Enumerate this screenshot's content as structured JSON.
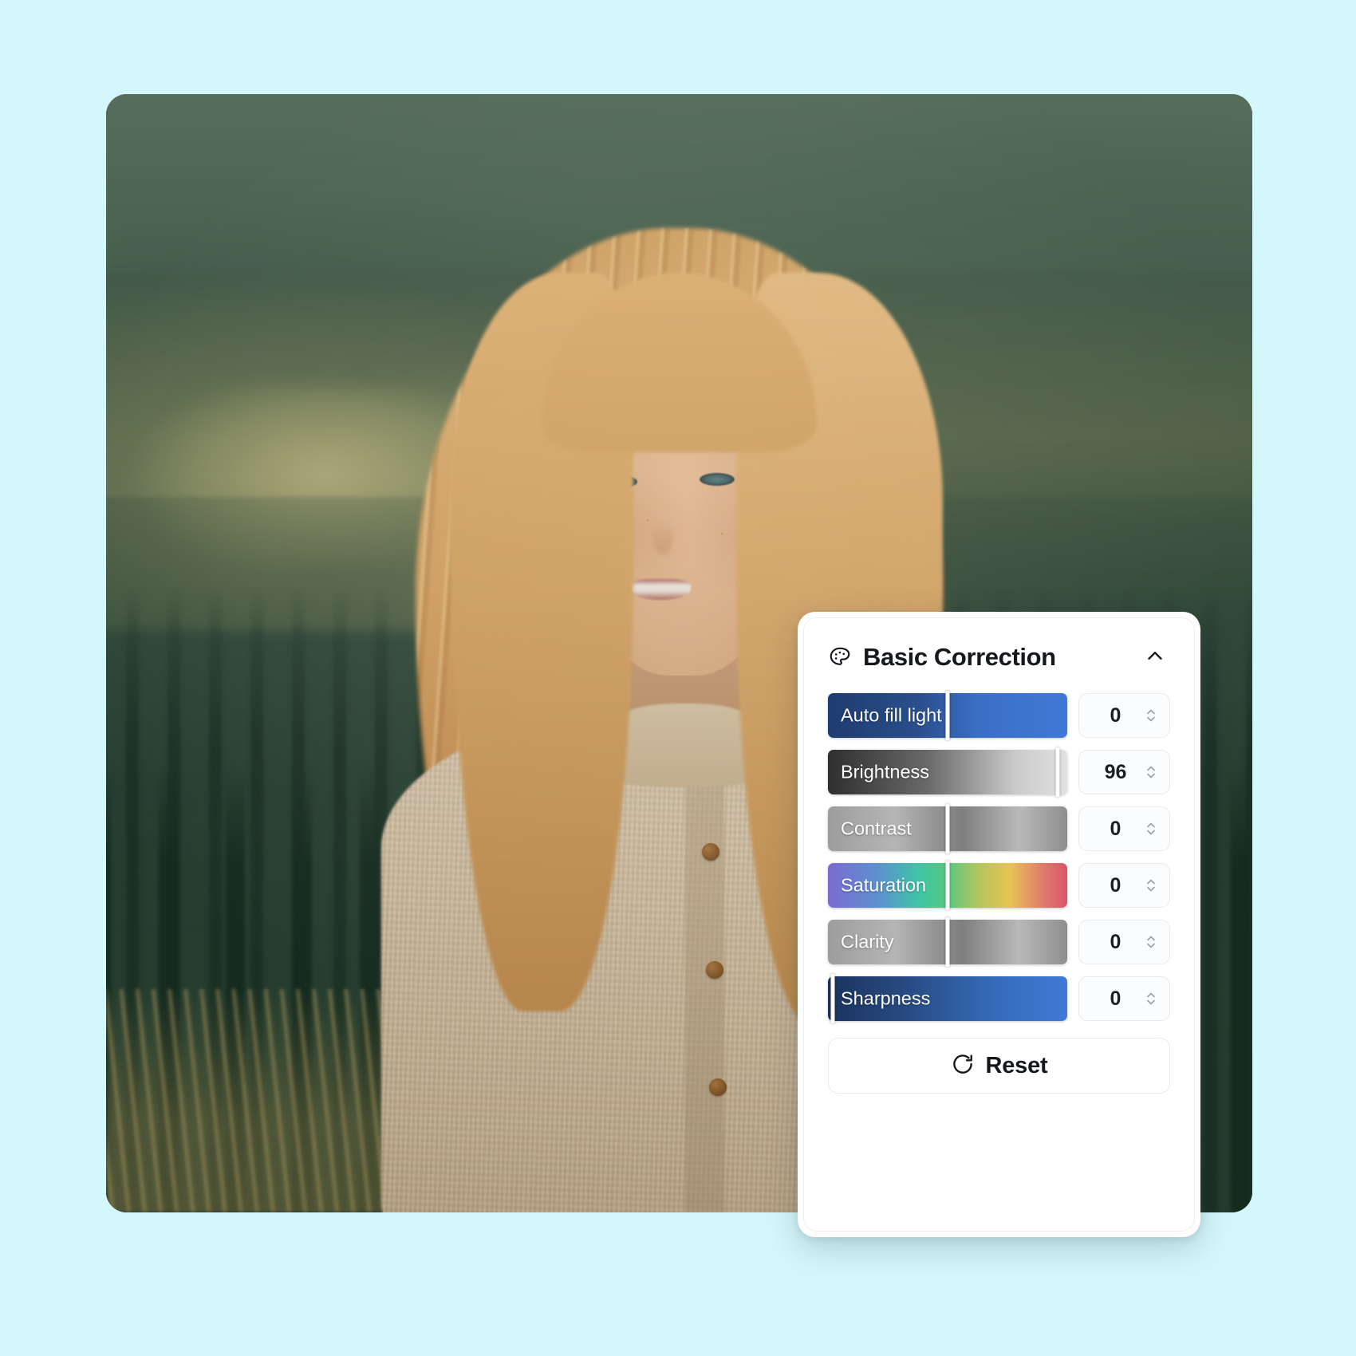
{
  "theme": {
    "background_color": "#d3f7fb",
    "panel_background": "#ffffff",
    "accent_blue": "#4079d6",
    "text_color": "#15181c"
  },
  "photo": {
    "alt": "Smiling blonde woman in a beige knit cardigan sitting in front of a pine forest hillside"
  },
  "panel": {
    "title": "Basic Correction",
    "title_icon": "palette-icon",
    "collapse_icon": "chevron-up-icon",
    "sliders": [
      {
        "label": "Auto fill light",
        "value": "0",
        "track": "blue",
        "handle_percent": 50,
        "stepper_icon": "stepper-updown-icon"
      },
      {
        "label": "Brightness",
        "value": "96",
        "track": "gray",
        "handle_percent": 96,
        "stepper_icon": "stepper-updown-icon"
      },
      {
        "label": "Contrast",
        "value": "0",
        "track": "neutral",
        "handle_percent": 50,
        "stepper_icon": "stepper-updown-icon"
      },
      {
        "label": "Saturation",
        "value": "0",
        "track": "rainbow",
        "handle_percent": 50,
        "stepper_icon": "stepper-updown-icon"
      },
      {
        "label": "Clarity",
        "value": "0",
        "track": "neutral",
        "handle_percent": 50,
        "stepper_icon": "stepper-updown-icon"
      },
      {
        "label": "Sharpness",
        "value": "0",
        "track": "sharp",
        "handle_percent": 2,
        "stepper_icon": "stepper-updown-icon"
      }
    ],
    "reset": {
      "label": "Reset",
      "icon": "refresh-icon"
    }
  }
}
